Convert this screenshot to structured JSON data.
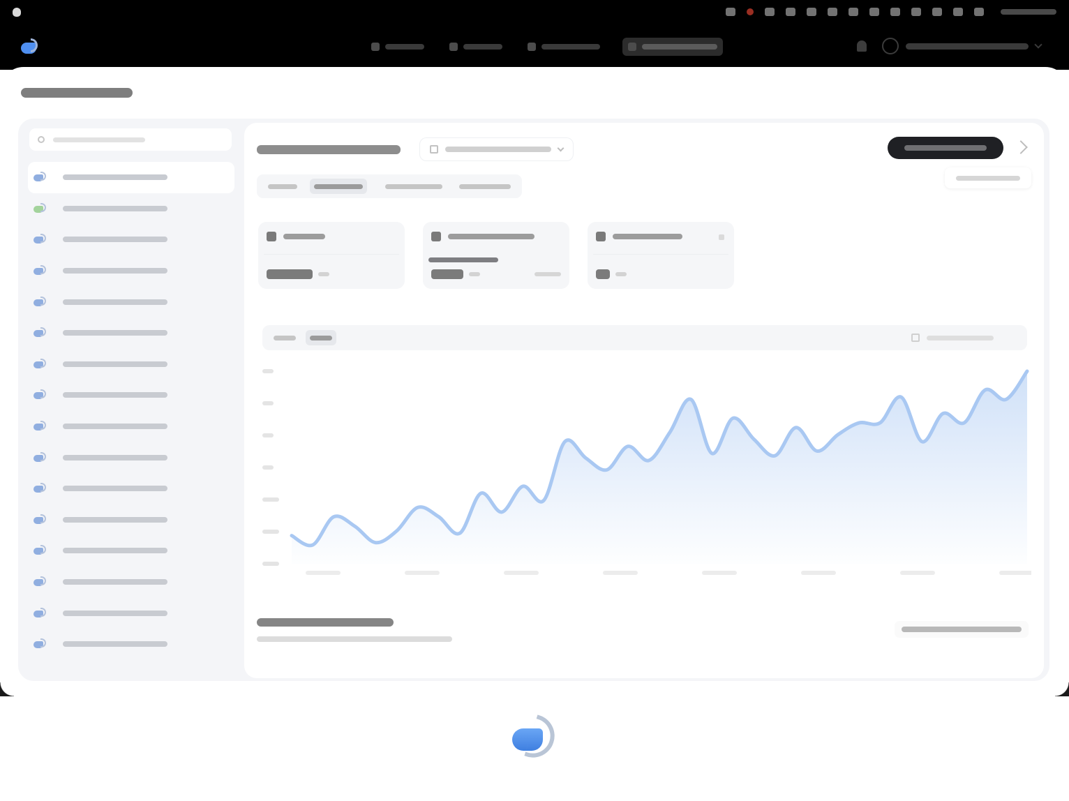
{
  "colors": {
    "topbar": "#000000",
    "panel": "#f4f5f8",
    "accent": "#4f8ff0",
    "chart_line": "#a9c8f2",
    "primary_button": "#1f2024"
  },
  "icons": {
    "brand": "brand-logo-icon",
    "bell": "bell-icon",
    "search": "search-icon",
    "calendar": "calendar-icon",
    "share": "share-icon",
    "org": "org-logo-icon"
  },
  "chart_data": {
    "type": "area",
    "title": "",
    "xlabel": "",
    "ylabel": "",
    "y_tick_count": 7,
    "x_tick_count": 8,
    "grid": false,
    "series": [
      {
        "name": "",
        "values": [
          12,
          8,
          20,
          16,
          9,
          14,
          24,
          20,
          13,
          30,
          22,
          33,
          27,
          52,
          45,
          40,
          50,
          44,
          56,
          70,
          47,
          62,
          53,
          46,
          58,
          48,
          55,
          60,
          60,
          71,
          52,
          64,
          60,
          74,
          70,
          82
        ]
      }
    ]
  }
}
